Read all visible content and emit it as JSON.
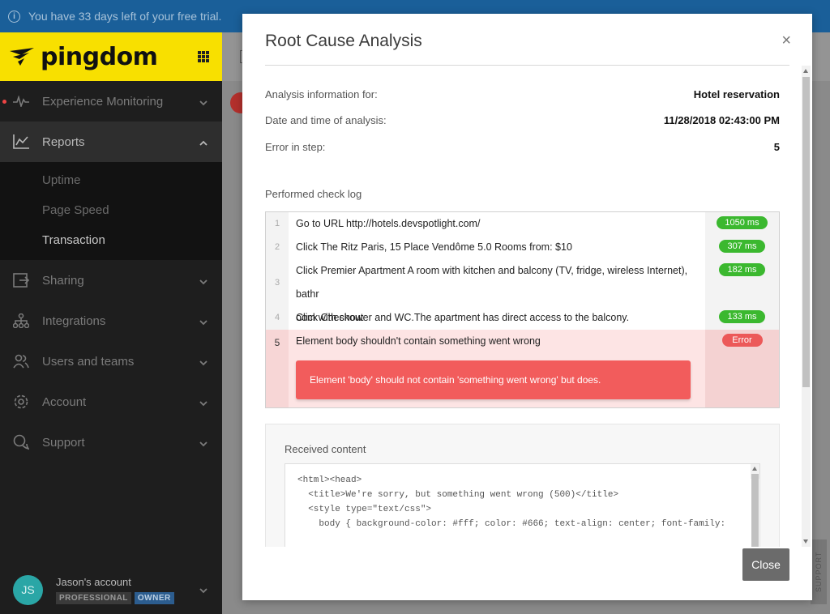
{
  "trial_banner": {
    "text": "You have 33 days left of your free trial.",
    "icon": "info-icon"
  },
  "brand": {
    "name": "pingdom",
    "logo_color": "#f8e000"
  },
  "sidebar": {
    "items": [
      {
        "label": "Experience Monitoring",
        "icon": "pulse-icon",
        "expanded": false
      },
      {
        "label": "Reports",
        "icon": "chart-icon",
        "expanded": true,
        "children": [
          {
            "label": "Uptime"
          },
          {
            "label": "Page Speed"
          },
          {
            "label": "Transaction",
            "current": true
          }
        ]
      },
      {
        "label": "Sharing",
        "icon": "share-icon",
        "expanded": false
      },
      {
        "label": "Integrations",
        "icon": "integrations-icon",
        "expanded": false
      },
      {
        "label": "Users and teams",
        "icon": "users-icon",
        "expanded": false
      },
      {
        "label": "Account",
        "icon": "gear-icon",
        "expanded": false
      },
      {
        "label": "Support",
        "icon": "chat-icon",
        "expanded": false
      }
    ],
    "account": {
      "initials": "JS",
      "name": "Jason's account",
      "plan": "PROFESSIONAL",
      "role": "OWNER"
    }
  },
  "support_tab": {
    "label": "SUPPORT"
  },
  "modal": {
    "title": "Root Cause Analysis",
    "close_symbol": "×",
    "info": [
      {
        "label": "Analysis information for:",
        "value": "Hotel reservation"
      },
      {
        "label": "Date and time of analysis:",
        "value": "11/28/2018 02:43:00 PM"
      },
      {
        "label": "Error in step:",
        "value": "5"
      }
    ],
    "log_title": "Performed check log",
    "log": [
      {
        "num": "1",
        "text": "Go to URL http://hotels.devspotlight.com/",
        "time": "1050 ms",
        "status": "ok"
      },
      {
        "num": "2",
        "text": "Click The Ritz Paris, 15 Place Vendôme 5.0 Rooms from: $10",
        "time": "307 ms",
        "status": "ok"
      },
      {
        "num": "3",
        "text_line1": "Click Premier Apartment A room with kitchen and balcony (TV, fridge, wireless Internet), bathr",
        "text_line2": "oom with shower and WC.The apartment has direct access to the balcony.",
        "time": "182 ms",
        "status": "ok"
      },
      {
        "num": "4",
        "text": "Click Checkout",
        "time": "133 ms",
        "status": "ok"
      },
      {
        "num": "5",
        "text": "Element body shouldn't contain something went wrong",
        "time": "Error",
        "status": "error",
        "error_message": "Element 'body' should not contain 'something went wrong' but does."
      }
    ],
    "received": {
      "title": "Received content",
      "code_lines": [
        "<html><head>",
        "  <title>We're sorry, but something went wrong (500)</title>",
        "  <style type=\"text/css\">",
        "    body { background-color: #fff; color: #666; text-align: center; font-family:"
      ]
    },
    "close_button": "Close"
  }
}
